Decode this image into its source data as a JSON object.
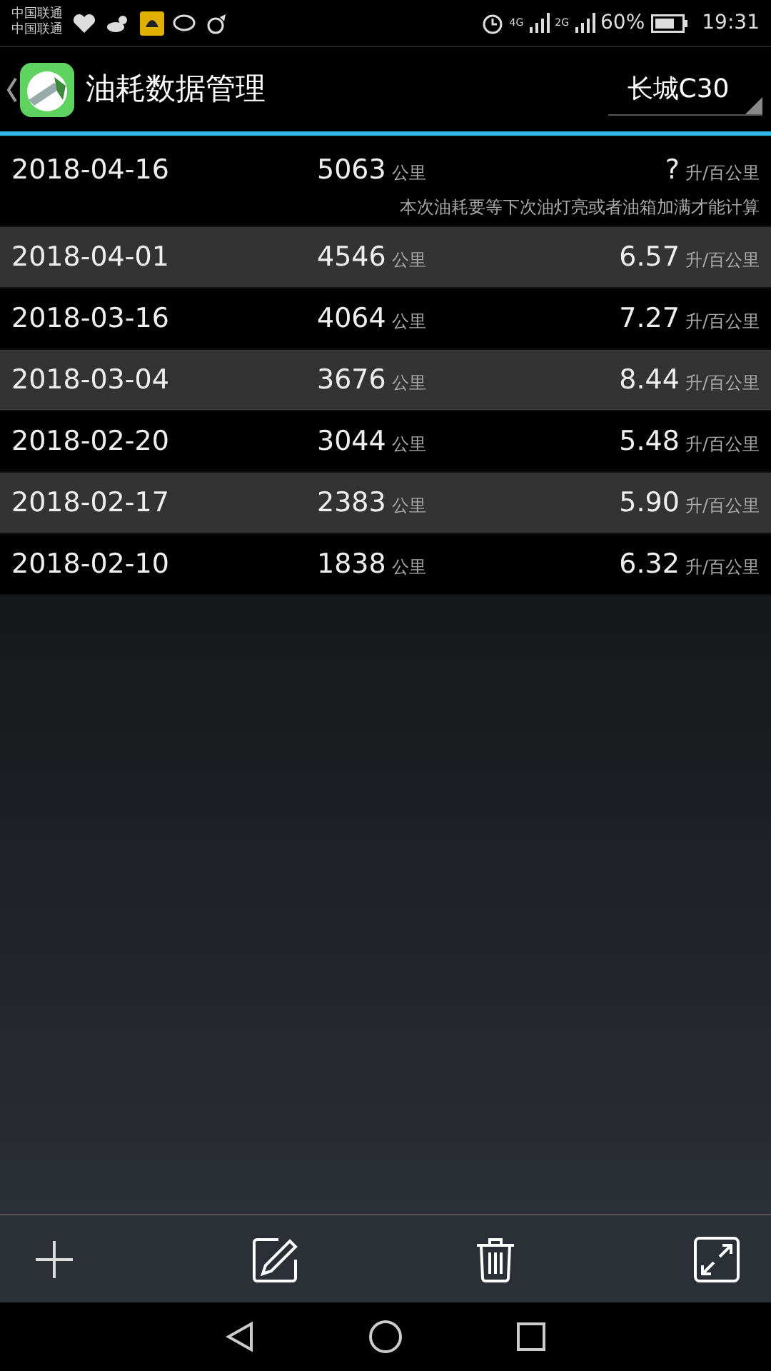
{
  "status_bar": {
    "carriers": [
      "中国联通",
      "中国联通"
    ],
    "network_labels": [
      "4G",
      "2G"
    ],
    "battery": "60%",
    "time": "19:31"
  },
  "header": {
    "title": "油耗数据管理",
    "car_selector": "长城C30"
  },
  "records": [
    {
      "date": "2018-04-16",
      "distance": "5063",
      "distance_unit": "公里",
      "consumption": "?",
      "consumption_unit": "升/百公里",
      "note": "本次油耗要等下次油灯亮或者油箱加满才能计算"
    },
    {
      "date": "2018-04-01",
      "distance": "4546",
      "distance_unit": "公里",
      "consumption": "6.57",
      "consumption_unit": "升/百公里"
    },
    {
      "date": "2018-03-16",
      "distance": "4064",
      "distance_unit": "公里",
      "consumption": "7.27",
      "consumption_unit": "升/百公里"
    },
    {
      "date": "2018-03-04",
      "distance": "3676",
      "distance_unit": "公里",
      "consumption": "8.44",
      "consumption_unit": "升/百公里"
    },
    {
      "date": "2018-02-20",
      "distance": "3044",
      "distance_unit": "公里",
      "consumption": "5.48",
      "consumption_unit": "升/百公里"
    },
    {
      "date": "2018-02-17",
      "distance": "2383",
      "distance_unit": "公里",
      "consumption": "5.90",
      "consumption_unit": "升/百公里"
    },
    {
      "date": "2018-02-10",
      "distance": "1838",
      "distance_unit": "公里",
      "consumption": "6.32",
      "consumption_unit": "升/百公里"
    }
  ]
}
